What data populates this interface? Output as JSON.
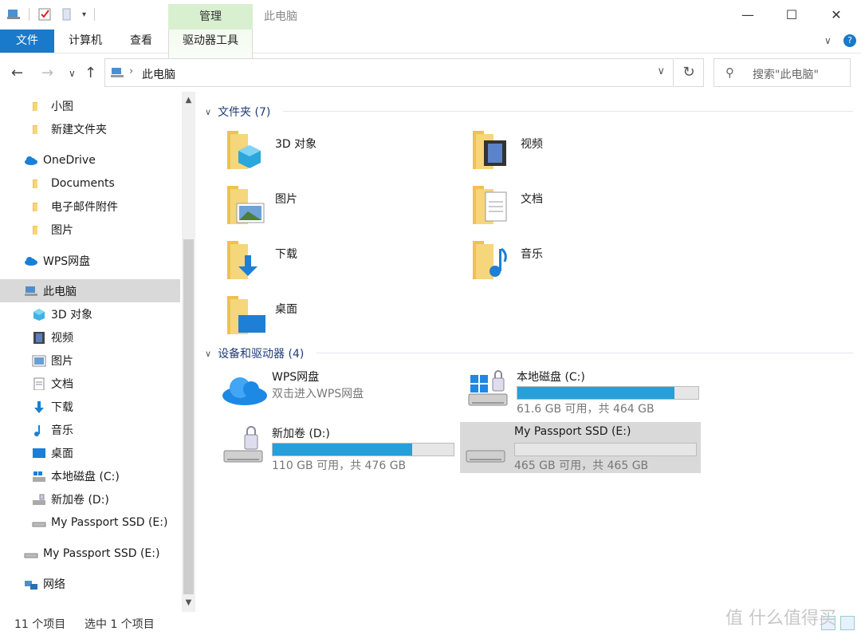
{
  "window": {
    "title": "此电脑",
    "manage_tab": "管理",
    "minimize": "—",
    "maximize": "☐",
    "close": "✕"
  },
  "ribbon": {
    "tabs": [
      "文件",
      "计算机",
      "查看",
      "驱动器工具"
    ],
    "collapse": "∨",
    "help": "?"
  },
  "address": {
    "path": "此电脑",
    "refresh": "↻",
    "search_placeholder": "搜索\"此电脑\""
  },
  "sidebar": {
    "items": [
      {
        "label": "小图",
        "icon": "folder-icon"
      },
      {
        "label": "新建文件夹",
        "icon": "folder-icon"
      },
      {
        "label": "OneDrive",
        "icon": "cloud-icon"
      },
      {
        "label": "Documents",
        "icon": "folder-icon"
      },
      {
        "label": "电子邮件附件",
        "icon": "folder-icon"
      },
      {
        "label": "图片",
        "icon": "folder-icon"
      },
      {
        "label": "WPS网盘",
        "icon": "cloud-icon"
      },
      {
        "label": "此电脑",
        "icon": "computer-icon"
      },
      {
        "label": "3D 对象",
        "icon": "cube-icon"
      },
      {
        "label": "视频",
        "icon": "film-icon"
      },
      {
        "label": "图片",
        "icon": "picture-icon"
      },
      {
        "label": "文档",
        "icon": "document-icon"
      },
      {
        "label": "下载",
        "icon": "download-icon"
      },
      {
        "label": "音乐",
        "icon": "music-icon"
      },
      {
        "label": "桌面",
        "icon": "desktop-icon"
      },
      {
        "label": "本地磁盘 (C:)",
        "icon": "windows-drive-icon"
      },
      {
        "label": "新加卷 (D:)",
        "icon": "drive-icon"
      },
      {
        "label": "My Passport SSD (E:)",
        "icon": "usb-drive-icon"
      },
      {
        "label": "My Passport SSD (E:)",
        "icon": "usb-drive-icon"
      },
      {
        "label": "网络",
        "icon": "network-icon"
      }
    ]
  },
  "folders": {
    "header": "文件夹 (7)",
    "items": [
      {
        "label": "3D 对象",
        "icon": "cube-folder-icon"
      },
      {
        "label": "视频",
        "icon": "video-folder-icon"
      },
      {
        "label": "图片",
        "icon": "picture-folder-icon"
      },
      {
        "label": "文档",
        "icon": "document-folder-icon"
      },
      {
        "label": "下载",
        "icon": "download-folder-icon"
      },
      {
        "label": "音乐",
        "icon": "music-folder-icon"
      },
      {
        "label": "桌面",
        "icon": "desktop-folder-icon"
      }
    ]
  },
  "devices": {
    "header": "设备和驱动器 (4)",
    "items": [
      {
        "label": "WPS网盘",
        "sub": "双击进入WPS网盘",
        "icon": "wps-cloud-icon",
        "fill": null
      },
      {
        "label": "本地磁盘 (C:)",
        "sub": "61.6 GB 可用，共 464 GB",
        "icon": "windows-drive-icon",
        "fill": 0.87
      },
      {
        "label": "新加卷 (D:)",
        "sub": "110 GB 可用，共 476 GB",
        "icon": "drive-icon",
        "fill": 0.77
      },
      {
        "label": "My Passport SSD (E:)",
        "sub": "465 GB 可用，共 465 GB",
        "icon": "usb-drive-icon",
        "fill": 0.0
      }
    ]
  },
  "status": {
    "count": "11 个项目",
    "selected": "选中 1 个项目"
  },
  "watermark": "值 什么值得买",
  "colors": {
    "accent": "#1979ca",
    "manage_tab": "#d9f0d0",
    "bar_fill": "#26a0da",
    "selection": "#d9d9d9"
  }
}
